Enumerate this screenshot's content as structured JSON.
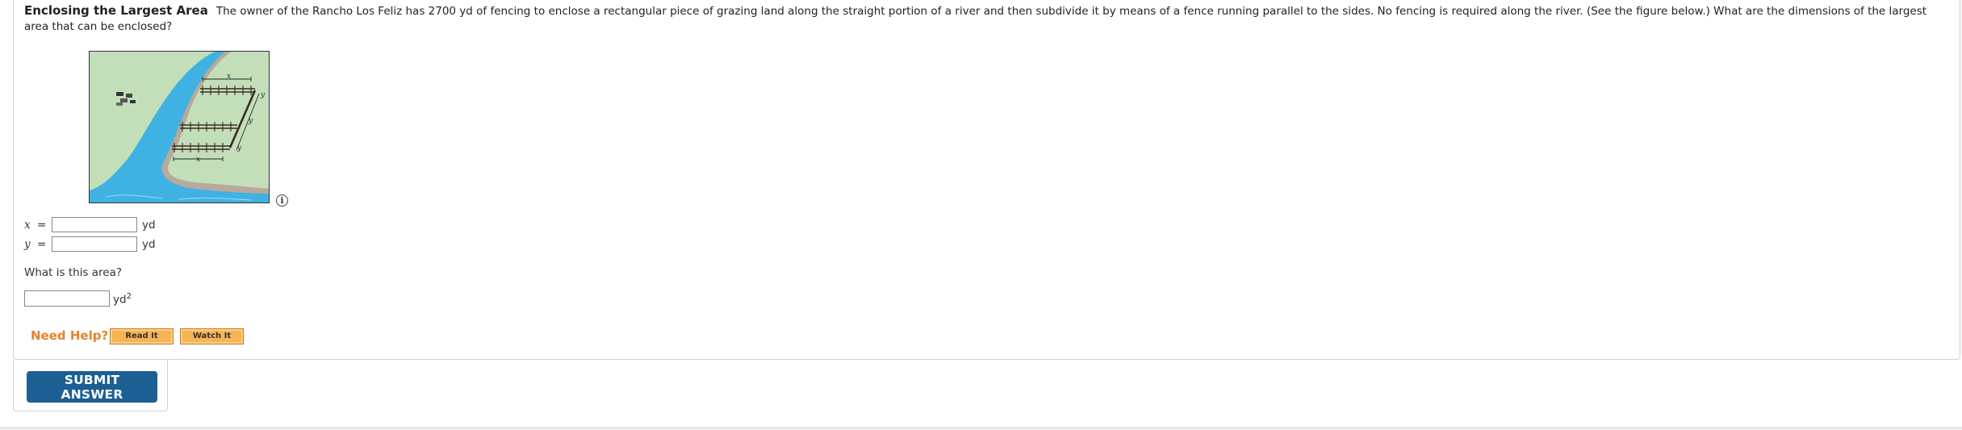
{
  "question": {
    "title": "Enclosing the Largest Area",
    "body": "The owner of the Rancho Los Feliz has 2700 yd of fencing to enclose a rectangular piece of grazing land along the straight portion of a river and then subdivide it by means of a fence running parallel to the sides. No fencing is required along the river. (See the figure below.) What are the dimensions of the largest area that can be enclosed?"
  },
  "figure": {
    "label_x_top": "x",
    "label_x_bottom": "x",
    "label_y_right": "y",
    "label_y_mid": "y",
    "label_y_corner": "y"
  },
  "answers": {
    "x": {
      "var": "x",
      "eq": "=",
      "value": "",
      "unit": "yd"
    },
    "y": {
      "var": "y",
      "eq": "=",
      "value": "",
      "unit": "yd"
    },
    "area_question": "What is this area?",
    "area": {
      "value": "",
      "unit": "yd",
      "unit_exp": "2"
    }
  },
  "help": {
    "label": "Need Help?",
    "read_it": "Read It",
    "watch_it": "Watch It"
  },
  "submit_label": "SUBMIT ANSWER",
  "colors": {
    "land": "#c3dfb9",
    "river": "#3fb2e3",
    "bank": "#b8a99b",
    "need_help": "#e8822a",
    "help_button": "#f7b455",
    "submit_button": "#1b5f93"
  }
}
